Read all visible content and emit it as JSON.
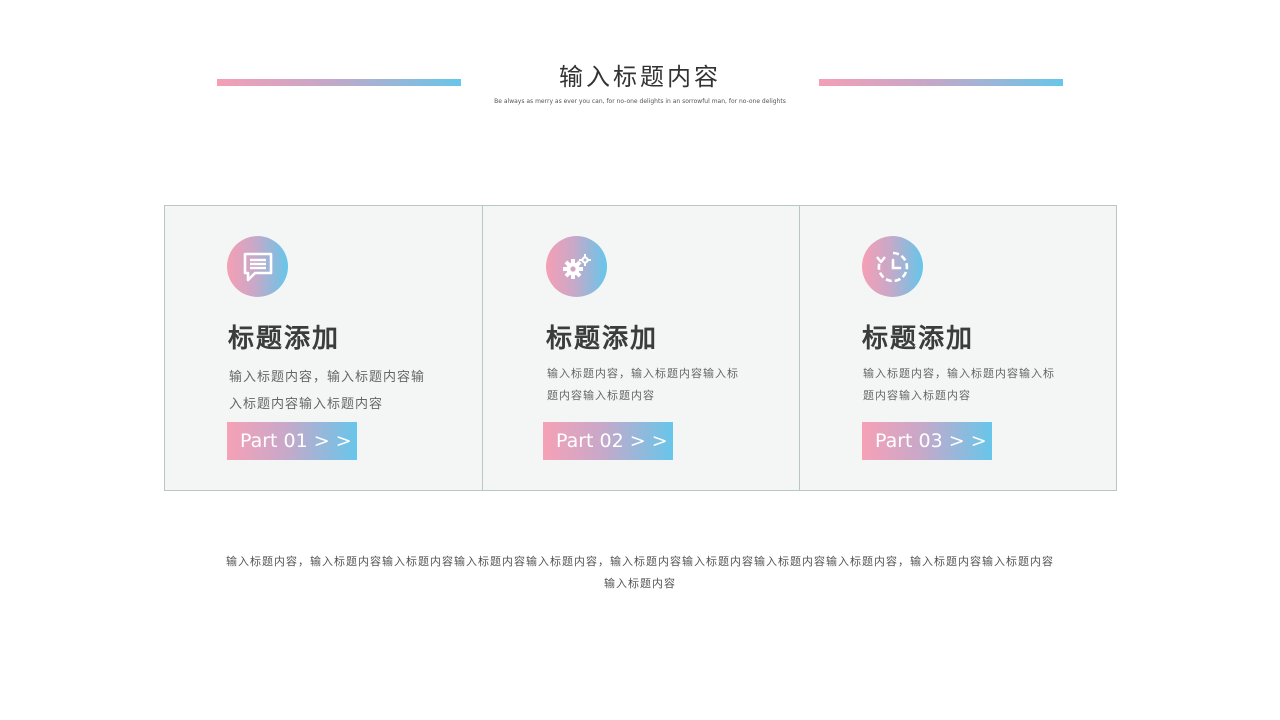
{
  "header": {
    "title": "输入标题内容",
    "subtitle": "Be always as merry as ever you can, for no-one delights in an sorrowful man, for no-one delights"
  },
  "cards": [
    {
      "icon": "chat-bubble-icon",
      "title": "标题添加",
      "text_lines": [
        "输入标题内容，输入标题内容输",
        "入标题内容输入标题内容"
      ],
      "button_label": "Part 01 > >"
    },
    {
      "icon": "gears-icon",
      "title": "标题添加",
      "text_lines": [
        "输入标题内容，输入标题内容输入标",
        "题内容输入标题内容"
      ],
      "button_label": "Part 02 > >"
    },
    {
      "icon": "clock-history-icon",
      "title": "标题添加",
      "text_lines": [
        "输入标题内容，输入标题内容输入标",
        "题内容输入标题内容"
      ],
      "button_label": "Part 03 > >"
    }
  ],
  "footer": {
    "line1": "输入标题内容，输入标题内容输入标题内容输入标题内容输入标题内容，输入标题内容输入标题内容输入标题内容输入标题内容，输入标题内容输入标题内容",
    "line2": "输入标题内容"
  },
  "colors": {
    "gradient_start": "#f49fb5",
    "gradient_end": "#67c6ea",
    "card_bg": "#f4f6f6",
    "card_border": "#b8c7c6"
  }
}
